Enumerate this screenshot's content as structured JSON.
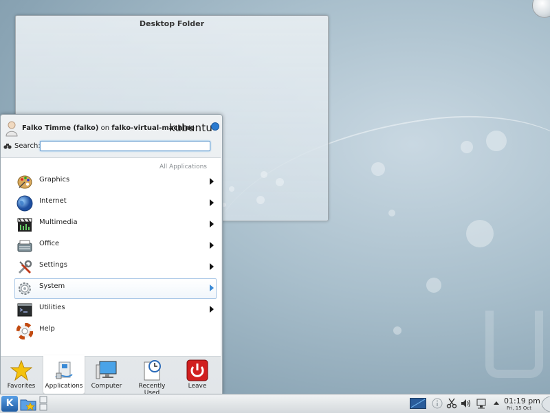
{
  "desktop": {
    "folder_title": "Desktop Folder"
  },
  "menu": {
    "user_name": "Falko Timme (falko)",
    "user_on": "on",
    "host": "falko-virtual-machine",
    "brand": "kubuntu",
    "search_label": "Search:",
    "search_value": "",
    "breadcrumb": "All Applications",
    "items": [
      {
        "label": "Graphics",
        "icon": "graphics-palette-icon"
      },
      {
        "label": "Internet",
        "icon": "globe-icon"
      },
      {
        "label": "Multimedia",
        "icon": "multimedia-icon"
      },
      {
        "label": "Office",
        "icon": "typewriter-icon"
      },
      {
        "label": "Settings",
        "icon": "tools-icon"
      },
      {
        "label": "System",
        "icon": "gear-icon"
      },
      {
        "label": "Utilities",
        "icon": "terminal-icon"
      },
      {
        "label": "Help",
        "icon": "lifebuoy-icon"
      }
    ],
    "highlighted_item": "System",
    "tabs": [
      {
        "label": "Favorites",
        "icon": "star-icon"
      },
      {
        "label": "Applications",
        "icon": "applications-icon"
      },
      {
        "label": "Computer",
        "icon": "computer-icon"
      },
      {
        "label": "Recently Used",
        "icon": "clock-document-icon"
      },
      {
        "label": "Leave",
        "icon": "power-icon"
      }
    ],
    "active_tab": "Applications"
  },
  "taskbar": {
    "launcher_glyph": "K",
    "clock_time": "01:19 pm",
    "clock_date": "Fri, 15 Oct"
  },
  "colors": {
    "accent": "#3a8ad6",
    "leave_red": "#d11f1f"
  }
}
